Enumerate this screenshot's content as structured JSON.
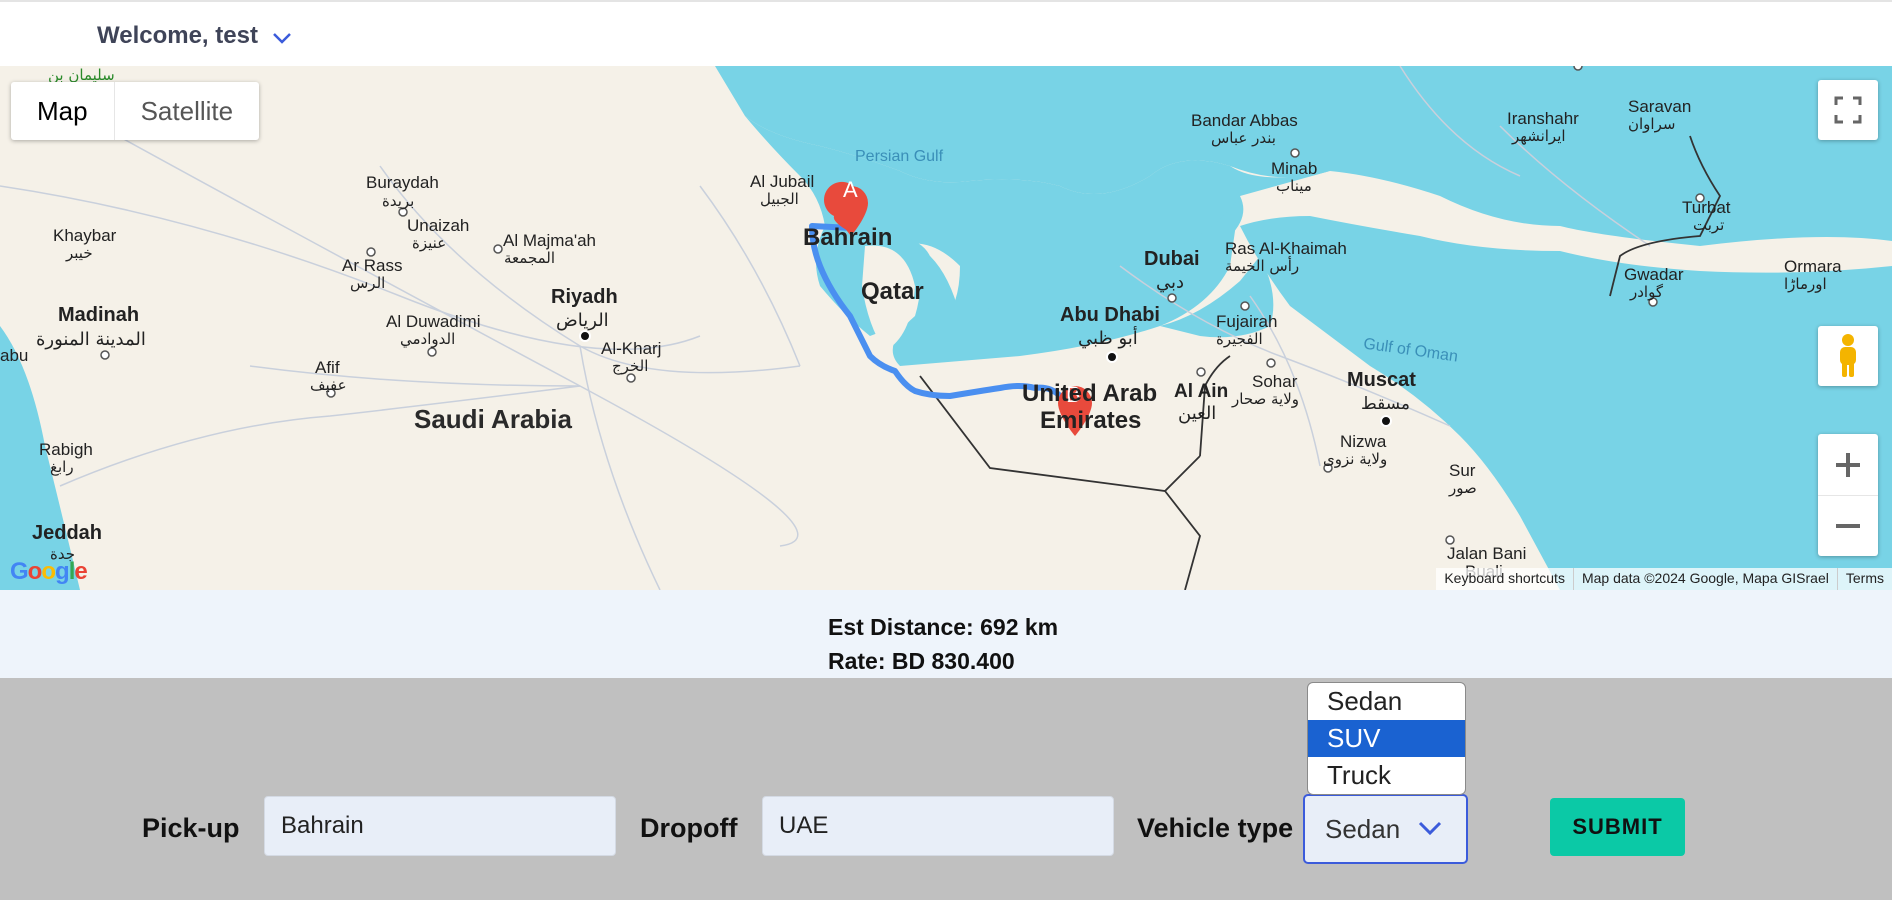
{
  "header": {
    "welcome": "Welcome, test"
  },
  "map": {
    "type_map": "Map",
    "type_satellite": "Satellite",
    "labels": {
      "persian_gulf": "Persian Gulf",
      "gulf_of_oman": "Gulf of Oman",
      "bahrain": "Bahrain",
      "qatar": "Qatar",
      "uae_line1": "United Arab",
      "uae_line2": "Emirates",
      "saudi": "Saudi Arabia",
      "riyadh": "Riyadh",
      "riyadh_ar": "الرياض",
      "dubai": "Dubai",
      "dubai_ar": "دبي",
      "abu_dhabi": "Abu Dhabi",
      "abu_dhabi_ar": "أبو ظبي",
      "muscat": "Muscat",
      "muscat_ar": "مسقط",
      "madinah": "Madinah",
      "madinah_ar": "المدينة المنورة",
      "jeddah": "Jeddah",
      "jeddah_ar": "جدة",
      "buraydah": "Buraydah",
      "buraydah_ar": "بريدة",
      "unaizah": "Unaizah",
      "unaizah_ar": "عنيزة",
      "khaybar": "Khaybar",
      "khaybar_ar": "خيبر",
      "ar_rass": "Ar Rass",
      "ar_rass_ar": "الرس",
      "al_majmaah": "Al Majma'ah",
      "al_majmaah_ar": "المجمعة",
      "al_duwadimi": "Al Duwadimi",
      "al_duwadimi_ar": "الدوادمي",
      "afif": "Afif",
      "afif_ar": "عفيف",
      "al_kharj": "Al-Kharj",
      "al_kharj_ar": "الخرج",
      "rabigh": "Rabigh",
      "rabigh_ar": "رابغ",
      "al_jubail": "Al Jubail",
      "al_jubail_ar": "الجبيل",
      "bandar_abbas": "Bandar Abbas",
      "bandar_abbas_ar": "بندر عباس",
      "minab": "Minab",
      "minab_ar": "میناب",
      "ras_al_khaimah": "Ras Al-Khaimah",
      "ras_al_khaimah_ar": "رأس الخيمة",
      "fujairah": "Fujairah",
      "fujairah_ar": "الفجيرة",
      "al_ain": "Al Ain",
      "al_ain_ar": "العين",
      "sohar": "Sohar",
      "sohar_ar": "ولاية صحار",
      "nizwa": "Nizwa",
      "nizwa_ar": "ولاية نزوى",
      "sur": "Sur",
      "sur_ar": "صور",
      "jalan": "Jalan Bani",
      "jalan_2": "Buali",
      "iranshahr": "Iranshahr",
      "iranshahr_ar": "ایرانشهر",
      "saravan": "Saravan",
      "saravan_ar": "سراوان",
      "turbat": "Turbat",
      "turbat_ar": "تربت",
      "gwadar": "Gwadar",
      "gwadar_ar": "گوادر",
      "ormara": "Ormara",
      "ormara_ar": "اورماڑا",
      "abu": "abu",
      "top_left_ar": "سليمان بن"
    },
    "marker_a": "A",
    "marker_b": "B",
    "google": "Google",
    "attribution": {
      "shortcuts": "Keyboard shortcuts",
      "data": "Map data ©2024 Google, Mapa GISrael",
      "terms": "Terms"
    }
  },
  "info": {
    "distance": "Est Distance: 692 km",
    "rate": "Rate: BD 830.400"
  },
  "form": {
    "pickup_label": "Pick-up",
    "pickup_value": "Bahrain",
    "dropoff_label": "Dropoff",
    "dropoff_value": "UAE",
    "vehicle_label": "Vehicle type",
    "vehicle_selected": "Sedan",
    "vehicle_options": [
      "Sedan",
      "SUV",
      "Truck"
    ],
    "highlighted_option": "SUV",
    "submit": "SUBMIT"
  },
  "colors": {
    "water": "#78d3e6",
    "land": "#f5f1e8",
    "route": "#4a8ff0",
    "marker": "#e84a3c",
    "submit": "#0bc9a6",
    "highlight": "#1a62d1"
  }
}
